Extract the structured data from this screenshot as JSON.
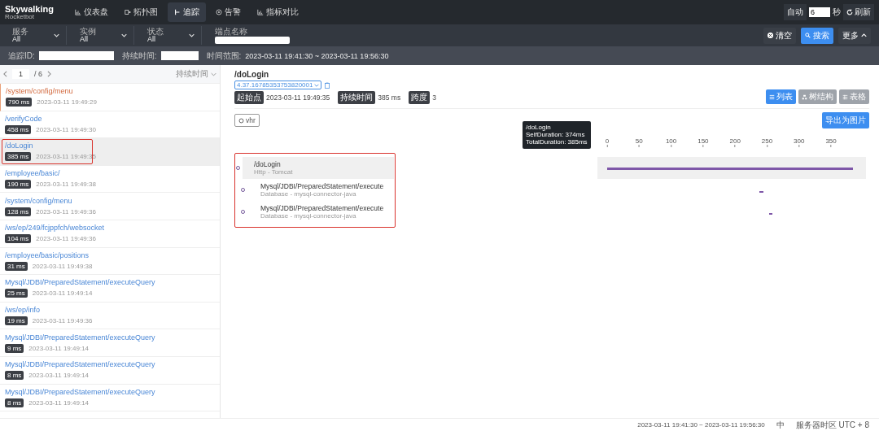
{
  "brand": {
    "name": "Skywalking",
    "subtitle": "Rocketbot"
  },
  "nav": [
    {
      "label": "仪表盘",
      "selected": false
    },
    {
      "label": "拓扑图",
      "selected": false
    },
    {
      "label": "追踪",
      "selected": true
    },
    {
      "label": "告警",
      "selected": false
    },
    {
      "label": "指标对比",
      "selected": false
    }
  ],
  "auto_refresh": {
    "label": "自动",
    "value": "6",
    "unit": "秒",
    "refresh": "刷新"
  },
  "filters": [
    {
      "label": "服务",
      "value": "All"
    },
    {
      "label": "实例",
      "value": "All"
    },
    {
      "label": "状态",
      "value": "All"
    }
  ],
  "endpoint_field": {
    "label": "端点名称"
  },
  "actions": {
    "clear": "清空",
    "search": "搜索",
    "more": "更多"
  },
  "search_row": {
    "trace_id_label": "追踪ID:",
    "duration_label": "持续时间:",
    "range_label": "时间范围:",
    "range": "2023-03-11 19:41:30 ~ 2023-03-11 19:56:30"
  },
  "pager": {
    "page": "1",
    "total": "/ 6",
    "sort": "持续时间"
  },
  "traces": [
    {
      "name": "/system/config/menu",
      "duration": "790 ms",
      "time": "2023-03-11 19:49:29",
      "error": true,
      "selected": false,
      "highlighted": false
    },
    {
      "name": "/verifyCode",
      "duration": "458 ms",
      "time": "2023-03-11 19:49:30",
      "error": false,
      "selected": false,
      "highlighted": false
    },
    {
      "name": "/doLogin",
      "duration": "385 ms",
      "time": "2023-03-11 19:49:35",
      "error": false,
      "selected": true,
      "highlighted": true
    },
    {
      "name": "/employee/basic/",
      "duration": "190 ms",
      "time": "2023-03-11 19:49:38",
      "error": false,
      "selected": false,
      "highlighted": false
    },
    {
      "name": "/system/config/menu",
      "duration": "128 ms",
      "time": "2023-03-11 19:49:36",
      "error": false,
      "selected": false,
      "highlighted": false
    },
    {
      "name": "/ws/ep/249/fcjppfch/websocket",
      "duration": "104 ms",
      "time": "2023-03-11 19:49:36",
      "error": false,
      "selected": false,
      "highlighted": false
    },
    {
      "name": "/employee/basic/positions",
      "duration": "31 ms",
      "time": "2023-03-11 19:49:38",
      "error": false,
      "selected": false,
      "highlighted": false
    },
    {
      "name": "Mysql/JDBI/PreparedStatement/executeQuery",
      "duration": "25 ms",
      "time": "2023-03-11 19:49:14",
      "error": false,
      "selected": false,
      "highlighted": false
    },
    {
      "name": "/ws/ep/info",
      "duration": "19 ms",
      "time": "2023-03-11 19:49:36",
      "error": false,
      "selected": false,
      "highlighted": false
    },
    {
      "name": "Mysql/JDBI/PreparedStatement/executeQuery",
      "duration": "9 ms",
      "time": "2023-03-11 19:49:14",
      "error": false,
      "selected": false,
      "highlighted": false
    },
    {
      "name": "Mysql/JDBI/PreparedStatement/executeQuery",
      "duration": "8 ms",
      "time": "2023-03-11 19:49:14",
      "error": false,
      "selected": false,
      "highlighted": false
    },
    {
      "name": "Mysql/JDBI/PreparedStatement/executeQuery",
      "duration": "8 ms",
      "time": "2023-03-11 19:49:14",
      "error": false,
      "selected": false,
      "highlighted": false
    }
  ],
  "detail": {
    "title": "/doLogin",
    "trace_id": "4.37.16785353753820001",
    "tags": [
      {
        "label": "起始点",
        "value": "2023-03-11 19:49:35"
      },
      {
        "label": "持续时间",
        "value": "385 ms"
      },
      {
        "label": "跨度",
        "value": "3"
      }
    ],
    "views": [
      {
        "label": "列表",
        "selected": true
      },
      {
        "label": "树结构",
        "selected": false
      },
      {
        "label": "表格",
        "selected": false
      }
    ],
    "service_chip": "vhr",
    "export": "导出为图片",
    "highlighted": true,
    "spans": [
      {
        "name": "/doLogin",
        "sub": "Http - Tomcat",
        "selected": true,
        "children": [
          {
            "name": "Mysql/JDBI/PreparedStatement/execute",
            "sub": "Database - mysql-connector-java",
            "selected": false
          },
          {
            "name": "Mysql/JDBI/PreparedStatement/execute",
            "sub": "Database - mysql-connector-java",
            "selected": false
          }
        ]
      }
    ],
    "tooltip": {
      "title": "/doLogin",
      "lines": [
        "SelfDuration: 374ms",
        "TotalDuration: 385ms"
      ]
    },
    "axis_ticks": [
      "0",
      "50",
      "100",
      "150",
      "200",
      "250",
      "300",
      "350"
    ]
  },
  "footer": {
    "range": "2023-03-11 19:41:30 ~ 2023-03-11 19:56:30",
    "lang": "中",
    "timezone": "服务器时区 UTC + 8"
  }
}
